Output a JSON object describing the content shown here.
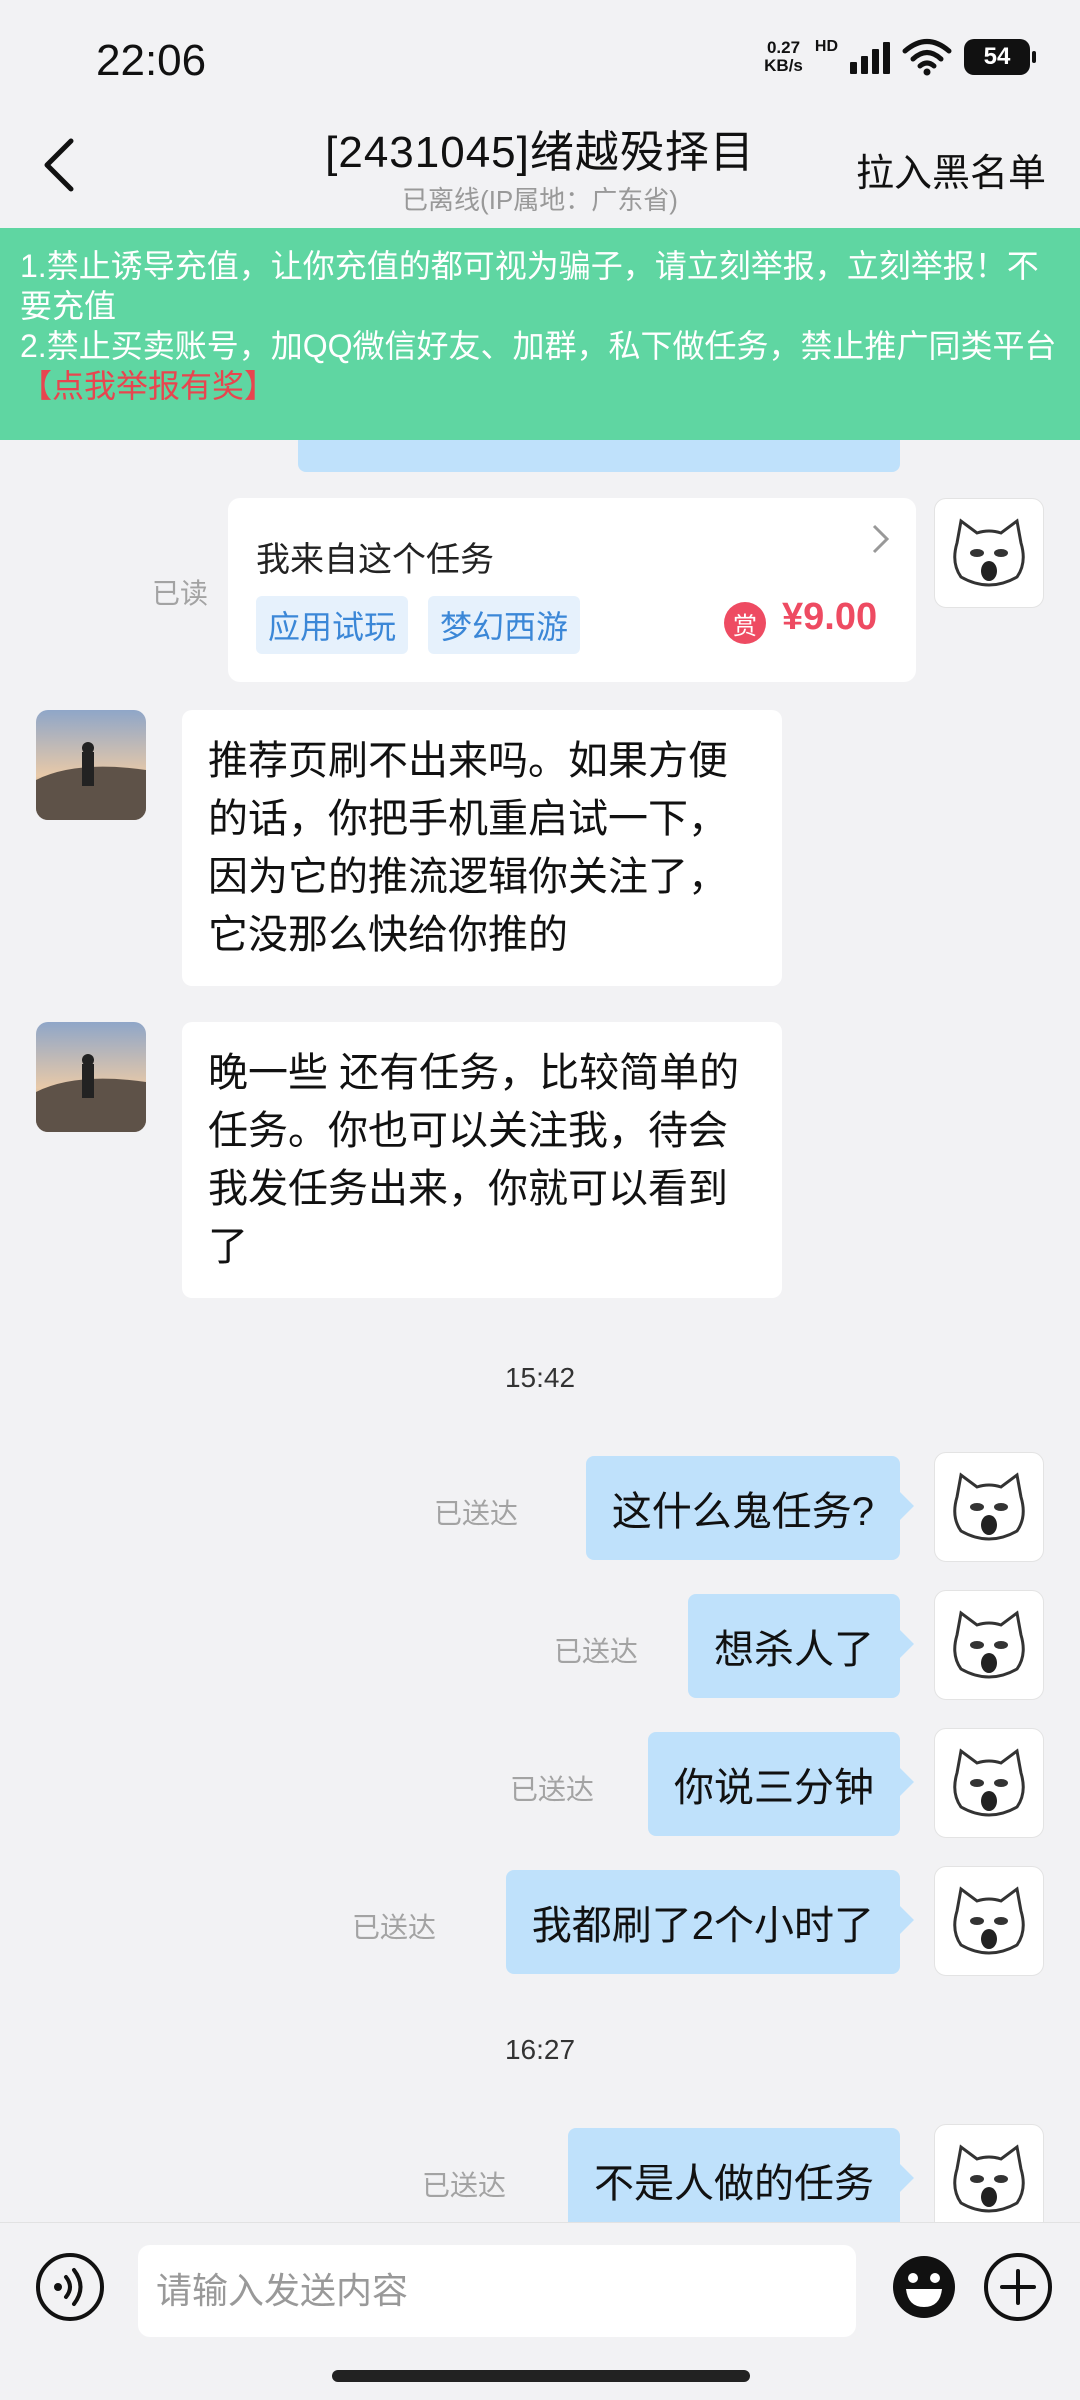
{
  "status_bar": {
    "time": "22:06",
    "net_speed_value": "0.27",
    "net_speed_unit": "KB/s",
    "hd_label": "HD",
    "battery": "54"
  },
  "header": {
    "title": "[2431045]绪越殁择目",
    "subtitle": "已离线(IP属地：广东省)",
    "blacklist_label": "拉入黑名单"
  },
  "notice": {
    "line1": "1.禁止诱导充值，让你充值的都可视为骗子，请立刻举报，立刻举报！不要充值",
    "line2": "2.禁止买卖账号，加QQ微信好友、加群，私下做任务，禁止推广同类平台",
    "report_link": "【点我举报有奖】"
  },
  "task_card": {
    "read_status": "已读",
    "title": "我来自这个任务",
    "tags": [
      "应用试玩",
      "梦幻西游"
    ],
    "reward_badge": "赏",
    "price": "¥9.00"
  },
  "messages": [
    {
      "side": "left",
      "text": "推荐页刷不出来吗。如果方便的话，你把手机重启试一下，因为它的推流逻辑你关注了，它没那么快给你推的"
    },
    {
      "side": "left",
      "text": "晚一些 还有任务，比较简单的任务。你也可以关注我，待会我发任务出来，你就可以看到了"
    },
    {
      "side": "time",
      "text": "15:42"
    },
    {
      "side": "right",
      "text": "这什么鬼任务?",
      "status": "已送达"
    },
    {
      "side": "right",
      "text": "想杀人了",
      "status": "已送达"
    },
    {
      "side": "right",
      "text": "你说三分钟",
      "status": "已送达"
    },
    {
      "side": "right",
      "text": "我都刷了2个小时了",
      "status": "已送达"
    },
    {
      "side": "time",
      "text": "16:27"
    },
    {
      "side": "right",
      "text": "不是人做的任务",
      "status": "已送达"
    }
  ],
  "input": {
    "placeholder": "请输入发送内容"
  },
  "icons": {
    "back": "back-arrow-icon",
    "voice": "voice-icon",
    "emoji": "emoji-icon",
    "plus": "plus-icon",
    "chevron": "chevron-right-icon"
  },
  "colors": {
    "notice_bg": "#5fd6a2",
    "sent_bubble": "#bfe1fb",
    "accent_red": "#ee4b62",
    "tag_blue": "#3b87d7"
  }
}
